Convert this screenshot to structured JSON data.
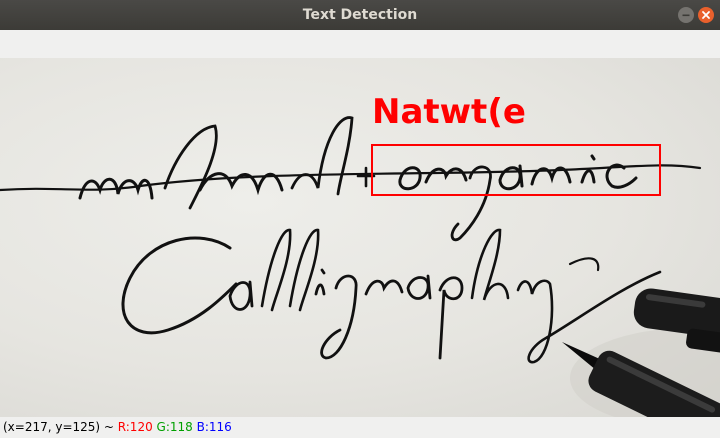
{
  "window": {
    "title": "Text Detection"
  },
  "controls": {
    "minimize_icon": "minimize-icon",
    "close_icon": "close-icon"
  },
  "detection": {
    "text": "Natwt(e",
    "color": "#ff0000"
  },
  "statusbar": {
    "coords": "(x=217, y=125) ~ ",
    "r": "R:120",
    "g": "G:118",
    "b": "B:116",
    "r_color": "#ff0000",
    "g_color": "#00a000",
    "b_color": "#0000ff"
  }
}
